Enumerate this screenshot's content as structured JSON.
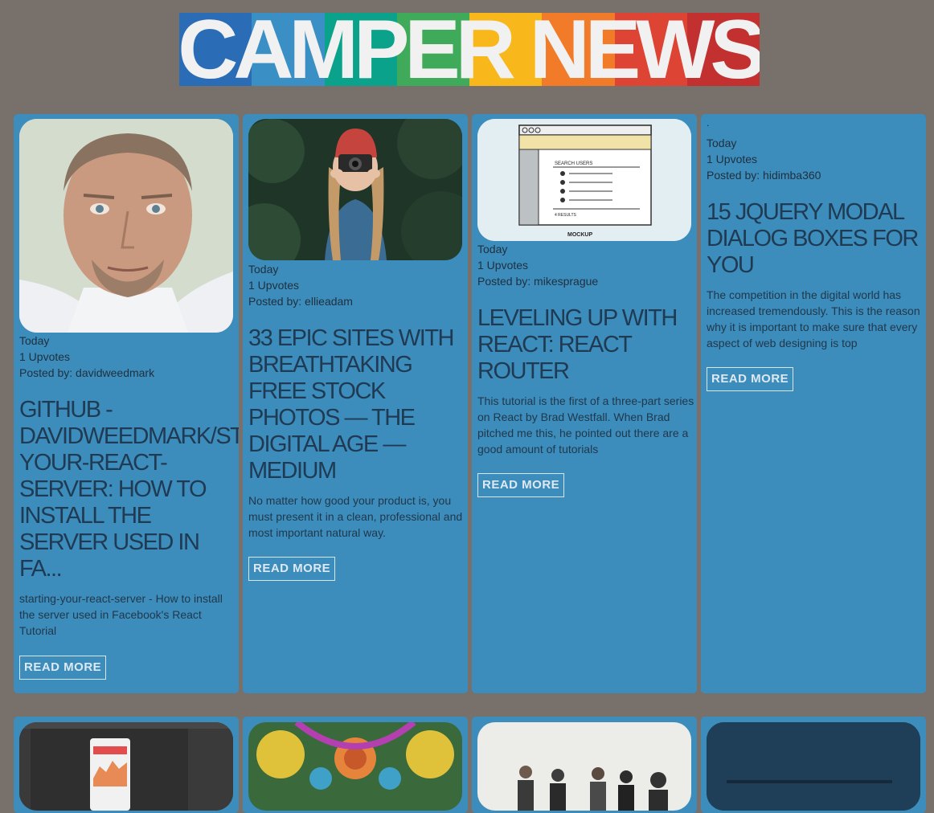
{
  "logo": {
    "text": "CAMPER NEWS",
    "stripe_colors": [
      "#2a6db6",
      "#3a8fc4",
      "#0aa28a",
      "#3faa5a",
      "#f8b81c",
      "#f27b2a",
      "#dd4433",
      "#c2312f"
    ]
  },
  "posts": [
    {
      "date": "Today",
      "upvotes": "1 Upvotes",
      "posted_by": "Posted by: davidweedmark",
      "title": "GITHUB -\nDAVIDWEEDMARK/ST\nYOUR-REACT-\nSERVER: HOW TO\nINSTALL THE\nSERVER USED IN\nFA...",
      "excerpt": "starting-your-react-server - How to install the server used in Facebook's React Tutorial",
      "button": "READ MORE"
    },
    {
      "date": "Today",
      "upvotes": "1 Upvotes",
      "posted_by": "Posted by: ellieadam",
      "title": "33 EPIC SITES WITH\nBREATHTAKING\nFREE STOCK\nPHOTOS — THE\nDIGITAL AGE —\nMEDIUM",
      "excerpt": "No matter how good your product is, you must present it in a clean, professional and most important natural way.",
      "button": "READ MORE"
    },
    {
      "date": "Today",
      "upvotes": "1 Upvotes",
      "posted_by": "Posted by: mikesprague",
      "title": "LEVELING UP WITH\nREACT: REACT\nROUTER",
      "excerpt": "This tutorial is the first of a three-part series on React by Brad Westfall. When Brad pitched me this, he pointed out there are a good amount of tutorials",
      "button": "READ MORE",
      "mockup": {
        "label": "SEARCH USERS",
        "results": "4 RESULTS",
        "caption": "MOCKUP"
      }
    },
    {
      "date": "Today",
      "upvotes": "1 Upvotes",
      "posted_by": "Posted by: hidimba360",
      "title": "15 JQUERY MODAL\nDIALOG BOXES FOR\nYOU",
      "excerpt": "The competition in the digital world has increased tremendously. This is the reason why it is important to make sure that every aspect of web designing is top",
      "button": "READ MORE",
      "dot": "."
    }
  ]
}
